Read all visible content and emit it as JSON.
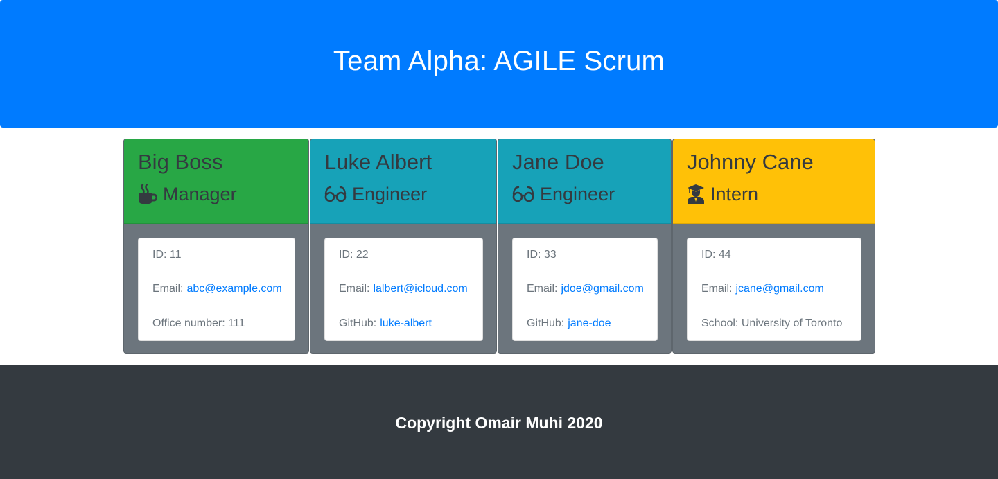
{
  "header": {
    "title": "Team Alpha: AGILE Scrum"
  },
  "colors": {
    "header_bg": "#007bff",
    "manager": "#28a745",
    "engineer": "#17a2b8",
    "intern": "#ffc107",
    "card_body": "#6c757d",
    "footer_bg": "#343a40",
    "link": "#007bff"
  },
  "cards": [
    {
      "name": "Big Boss",
      "role": "Manager",
      "icon": "coffee-icon",
      "id_label": "ID:",
      "id": "11",
      "email_label": "Email:",
      "email": "abc@example.com",
      "extra_label": "Office number:",
      "extra": "111"
    },
    {
      "name": "Luke Albert",
      "role": "Engineer",
      "icon": "glasses-icon",
      "id_label": "ID:",
      "id": "22",
      "email_label": "Email:",
      "email": "lalbert@icloud.com",
      "extra_label": "GitHub:",
      "extra": "luke-albert"
    },
    {
      "name": "Jane Doe",
      "role": "Engineer",
      "icon": "glasses-icon",
      "id_label": "ID:",
      "id": "33",
      "email_label": "Email:",
      "email": "jdoe@gmail.com",
      "extra_label": "GitHub:",
      "extra": "jane-doe"
    },
    {
      "name": "Johnny Cane",
      "role": "Intern",
      "icon": "graduate-icon",
      "id_label": "ID:",
      "id": "44",
      "email_label": "Email:",
      "email": "jcane@gmail.com",
      "extra_label": "School:",
      "extra": "University of Toronto"
    }
  ],
  "footer": {
    "text": "Copyright Omair Muhi 2020"
  }
}
